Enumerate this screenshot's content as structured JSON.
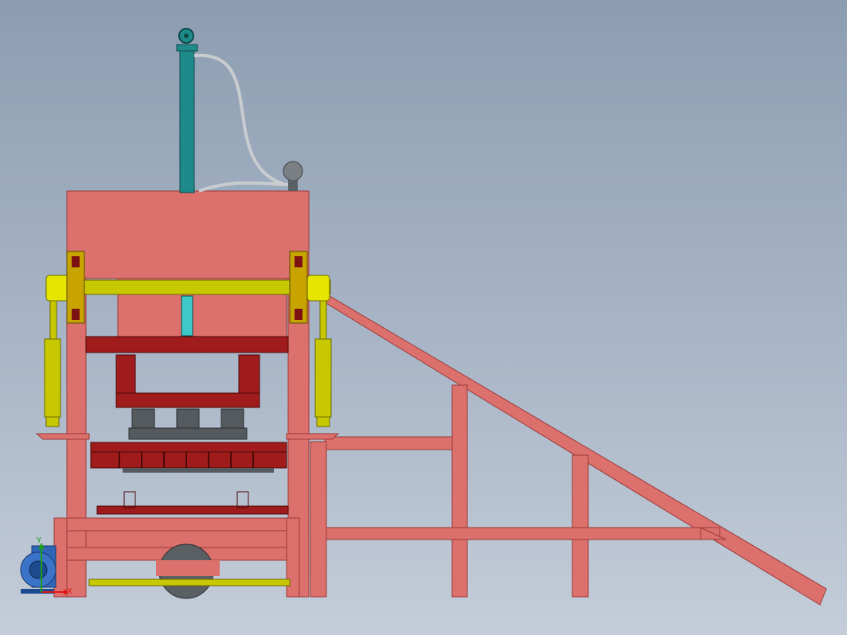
{
  "view": {
    "background_top": "#8d9db1",
    "background_bottom": "#c4cdd9"
  },
  "colors": {
    "frame": "#dc706c",
    "frame_edge": "#9a3a38",
    "steel_dark": "#7d1212",
    "steel_mid": "#a01c1c",
    "rod": "#c8c800",
    "rod_edge": "#6e6a00",
    "cylinder": "#1f8a8a",
    "gray": "#555a5e",
    "motor": "#2f66b8"
  },
  "icons": {
    "hydraulic_cylinder": "hydraulic-cylinder-icon",
    "pressure_gauge": "pressure-gauge-icon",
    "electric_motor": "electric-motor-icon",
    "axis_triad": "axis-triad-icon"
  },
  "axis_triad": {
    "x_label": "X",
    "y_label": "Y"
  }
}
